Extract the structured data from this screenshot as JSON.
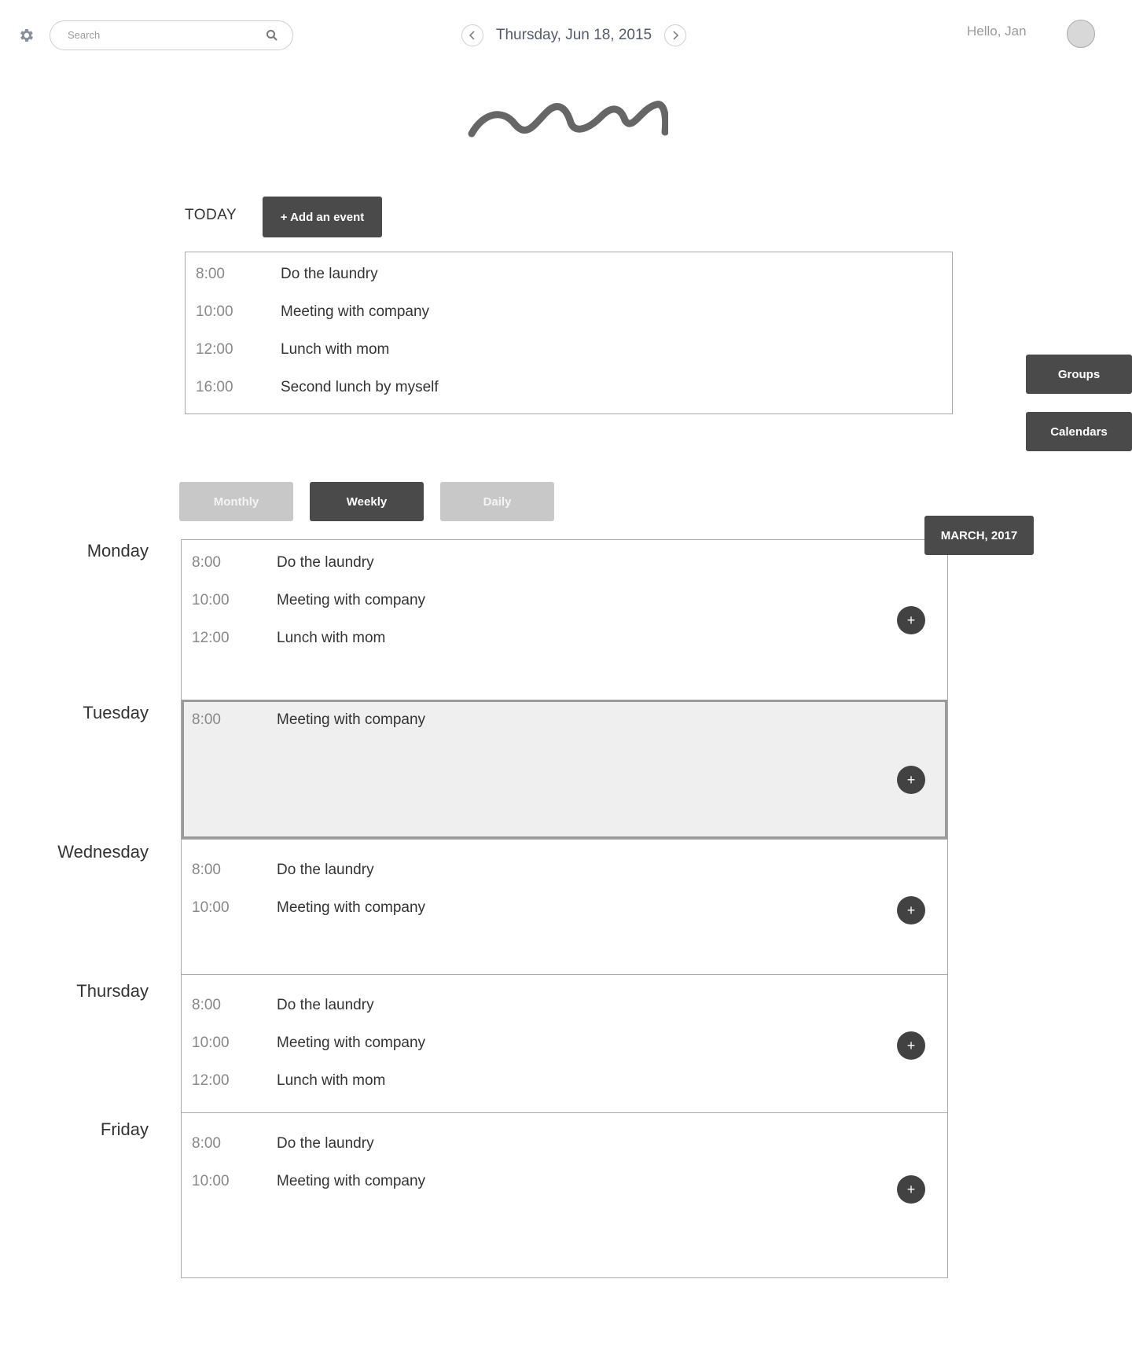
{
  "header": {
    "search_placeholder": "Search",
    "date": "Thursday, Jun 18, 2015",
    "greeting": "Hello, Jan"
  },
  "today": {
    "label": "TODAY",
    "add_button": "+ Add an event",
    "events": [
      {
        "time": "8:00",
        "desc": "Do the laundry"
      },
      {
        "time": "10:00",
        "desc": "Meeting with company"
      },
      {
        "time": "12:00",
        "desc": "Lunch with mom"
      },
      {
        "time": "16:00",
        "desc": "Second lunch by myself"
      }
    ]
  },
  "side": {
    "groups": "Groups",
    "calendars": "Calendars"
  },
  "views": {
    "monthly": "Monthly",
    "weekly": "Weekly",
    "daily": "Daily",
    "active": "Weekly"
  },
  "month_tag": "MARCH, 2017",
  "week": {
    "days": [
      {
        "name": "Monday",
        "events": [
          {
            "time": "8:00",
            "desc": "Do the laundry"
          },
          {
            "time": "10:00",
            "desc": "Meeting with company"
          },
          {
            "time": "12:00",
            "desc": "Lunch with mom"
          }
        ]
      },
      {
        "name": "Tuesday",
        "selected": true,
        "events": [
          {
            "time": "8:00",
            "desc": "Meeting with company"
          }
        ]
      },
      {
        "name": "Wednesday",
        "events": [
          {
            "time": "8:00",
            "desc": "Do the laundry"
          },
          {
            "time": "10:00",
            "desc": "Meeting with company"
          }
        ]
      },
      {
        "name": "Thursday",
        "events": [
          {
            "time": "8:00",
            "desc": "Do the laundry"
          },
          {
            "time": "10:00",
            "desc": "Meeting with company"
          },
          {
            "time": "12:00",
            "desc": "Lunch with mom"
          }
        ]
      },
      {
        "name": "Friday",
        "events": [
          {
            "time": "8:00",
            "desc": "Do the laundry"
          },
          {
            "time": "10:00",
            "desc": "Meeting with company"
          }
        ]
      }
    ]
  },
  "colors": {
    "dark": "#4a4a4a",
    "light_button": "#c8c8c8",
    "selected_bg": "#efefef"
  },
  "icons": {
    "settings": "gear-icon",
    "search": "search-icon",
    "prev": "chevron-left-icon",
    "next": "chevron-right-icon",
    "add": "plus-icon"
  }
}
